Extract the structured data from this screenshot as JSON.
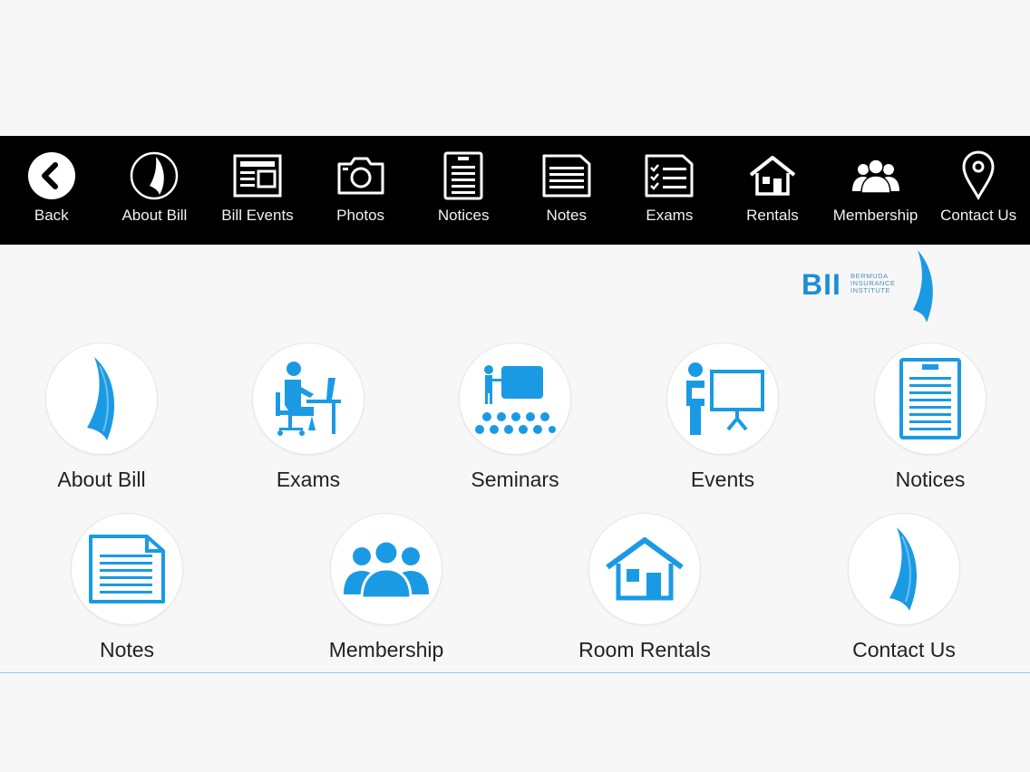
{
  "nav": {
    "items": [
      {
        "label": "Back",
        "icon": "back-arrow-icon"
      },
      {
        "label": "About Bill",
        "icon": "sail-icon"
      },
      {
        "label": "Bill Events",
        "icon": "newspaper-icon"
      },
      {
        "label": "Photos",
        "icon": "camera-icon"
      },
      {
        "label": "Notices",
        "icon": "notice-board-icon"
      },
      {
        "label": "Notes",
        "icon": "notes-icon"
      },
      {
        "label": "Exams",
        "icon": "checklist-icon"
      },
      {
        "label": "Rentals",
        "icon": "house-icon"
      },
      {
        "label": "Membership",
        "icon": "group-icon"
      },
      {
        "label": "Contact Us",
        "icon": "location-pin-icon"
      }
    ]
  },
  "logo": {
    "mark": "BII",
    "line1": "BERMUDA",
    "line2": "INSURANCE",
    "line3": "INSTITUTE"
  },
  "tiles": {
    "row1": [
      {
        "label": "About Bill",
        "icon": "sail-icon"
      },
      {
        "label": "Exams",
        "icon": "person-at-desk-icon"
      },
      {
        "label": "Seminars",
        "icon": "presentation-audience-icon"
      },
      {
        "label": "Events",
        "icon": "presenter-board-icon"
      },
      {
        "label": "Notices",
        "icon": "notice-board-icon"
      }
    ],
    "row2": [
      {
        "label": "Notes",
        "icon": "notes-icon"
      },
      {
        "label": "Membership",
        "icon": "group-icon"
      },
      {
        "label": "Room Rentals",
        "icon": "house-icon"
      },
      {
        "label": "Contact Us",
        "icon": "sail-icon"
      }
    ]
  },
  "colors": {
    "accent": "#1b9ae4",
    "topbar": "#000000",
    "background": "#f7f7f7"
  }
}
